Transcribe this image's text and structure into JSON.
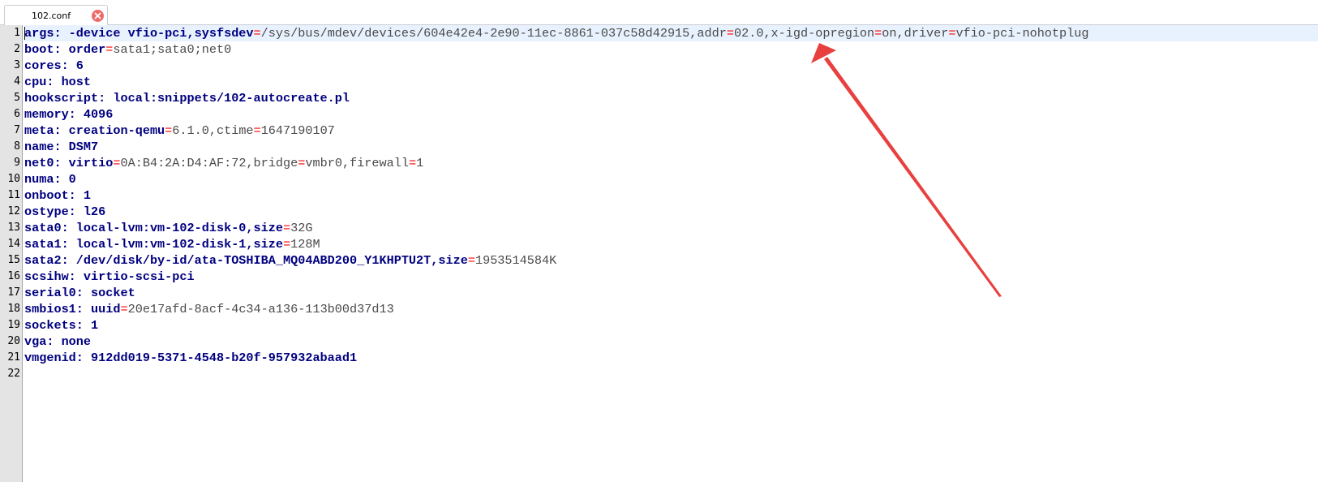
{
  "tab": {
    "title": "102.conf",
    "close_icon": "close-icon"
  },
  "annotation": {
    "color": "#e8403f",
    "icon": "arrow-annotation"
  },
  "editor": {
    "line_numbers": [
      "1",
      "2",
      "3",
      "4",
      "5",
      "6",
      "7",
      "8",
      "9",
      "10",
      "11",
      "12",
      "13",
      "14",
      "15",
      "16",
      "17",
      "18",
      "19",
      "20",
      "21",
      "22"
    ],
    "lines": [
      {
        "t": [
          [
            "k",
            "args: -device vfio-pci,sysfsdev"
          ],
          [
            "op",
            "="
          ],
          [
            "v",
            "/sys/bus/mdev/devices/604e42e4-2e90-11ec-8861-037c58d42915,addr"
          ],
          [
            "op",
            "="
          ],
          [
            "v",
            "02.0,x-igd-opregion"
          ],
          [
            "op",
            "="
          ],
          [
            "v",
            "on,driver"
          ],
          [
            "op",
            "="
          ],
          [
            "v",
            "vfio-pci-nohotplug"
          ]
        ]
      },
      {
        "t": [
          [
            "k",
            "boot: order"
          ],
          [
            "op",
            "="
          ],
          [
            "v",
            "sata1;sata0;net0"
          ]
        ]
      },
      {
        "t": [
          [
            "k",
            "cores: 6"
          ]
        ]
      },
      {
        "t": [
          [
            "k",
            "cpu: host"
          ]
        ]
      },
      {
        "t": [
          [
            "k",
            "hookscript: local:snippets/102-autocreate.pl"
          ]
        ]
      },
      {
        "t": [
          [
            "k",
            "memory: 4096"
          ]
        ]
      },
      {
        "t": [
          [
            "k",
            "meta: creation-qemu"
          ],
          [
            "op",
            "="
          ],
          [
            "v",
            "6.1.0,ctime"
          ],
          [
            "op",
            "="
          ],
          [
            "v",
            "1647190107"
          ]
        ]
      },
      {
        "t": [
          [
            "k",
            "name: DSM7"
          ]
        ]
      },
      {
        "t": [
          [
            "k",
            "net0: virtio"
          ],
          [
            "op",
            "="
          ],
          [
            "v",
            "0A:B4:2A:D4:AF:72,bridge"
          ],
          [
            "op",
            "="
          ],
          [
            "v",
            "vmbr0,firewall"
          ],
          [
            "op",
            "="
          ],
          [
            "v",
            "1"
          ]
        ]
      },
      {
        "t": [
          [
            "k",
            "numa: 0"
          ]
        ]
      },
      {
        "t": [
          [
            "k",
            "onboot: 1"
          ]
        ]
      },
      {
        "t": [
          [
            "k",
            "ostype: l26"
          ]
        ]
      },
      {
        "t": [
          [
            "k",
            "sata0: local-lvm:vm-102-disk-0,size"
          ],
          [
            "op",
            "="
          ],
          [
            "v",
            "32G"
          ]
        ]
      },
      {
        "t": [
          [
            "k",
            "sata1: local-lvm:vm-102-disk-1,size"
          ],
          [
            "op",
            "="
          ],
          [
            "v",
            "128M"
          ]
        ]
      },
      {
        "t": [
          [
            "k",
            "sata2: /dev/disk/by-id/ata-TOSHIBA_MQ04ABD200_Y1KHPTU2T,size"
          ],
          [
            "op",
            "="
          ],
          [
            "v",
            "1953514584K"
          ]
        ]
      },
      {
        "t": [
          [
            "k",
            "scsihw: virtio-scsi-pci"
          ]
        ]
      },
      {
        "t": [
          [
            "k",
            "serial0: socket"
          ]
        ]
      },
      {
        "t": [
          [
            "k",
            "smbios1: uuid"
          ],
          [
            "op",
            "="
          ],
          [
            "v",
            "20e17afd-8acf-4c34-a136-113b00d37d13"
          ]
        ]
      },
      {
        "t": [
          [
            "k",
            "sockets: 1"
          ]
        ]
      },
      {
        "t": [
          [
            "k",
            "vga: none"
          ]
        ]
      },
      {
        "t": [
          [
            "k",
            "vmgenid: 912dd019-5371-4548-b20f-957932abaad1"
          ]
        ]
      },
      {
        "t": []
      }
    ]
  }
}
